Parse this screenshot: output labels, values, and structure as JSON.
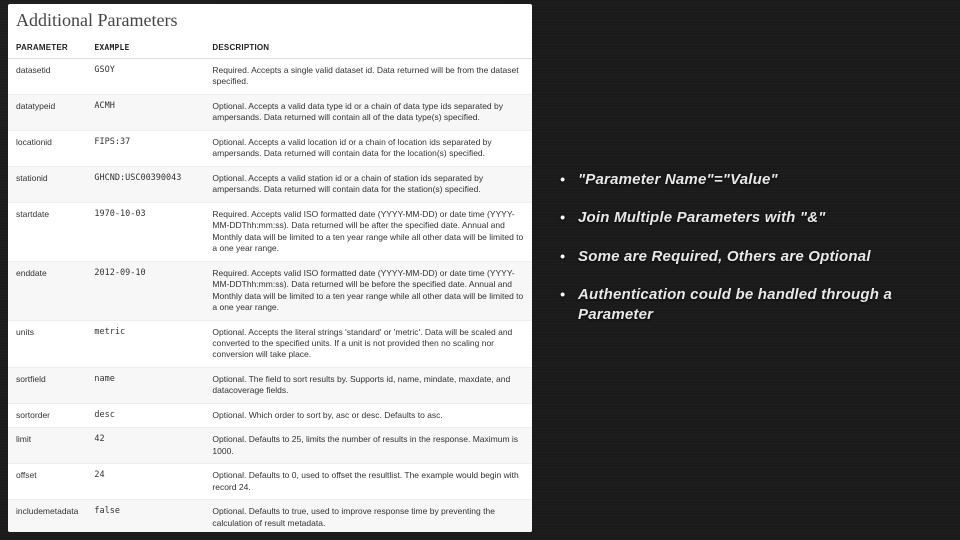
{
  "doc": {
    "title": "Additional Parameters",
    "headers": {
      "param": "PARAMETER",
      "example": "EXAMPLE",
      "desc": "DESCRIPTION"
    },
    "rows": [
      {
        "param": "datasetid",
        "example": "GSOY",
        "desc": "Required. Accepts a single valid dataset id. Data returned will be from the dataset specified."
      },
      {
        "param": "datatypeid",
        "example": "ACMH",
        "desc": "Optional. Accepts a valid data type id or a chain of data type ids separated by ampersands. Data returned will contain all of the data type(s) specified."
      },
      {
        "param": "locationid",
        "example": "FIPS:37",
        "desc": "Optional. Accepts a valid location id or a chain of location ids separated by ampersands. Data returned will contain data for the location(s) specified."
      },
      {
        "param": "stationid",
        "example": "GHCND:USC00390043",
        "desc": "Optional. Accepts a valid station id or a chain of station ids separated by ampersands. Data returned will contain data for the station(s) specified."
      },
      {
        "param": "startdate",
        "example": "1970-10-03",
        "desc": "Required. Accepts valid ISO formatted date (YYYY-MM-DD) or date time (YYYY-MM-DDThh:mm:ss). Data returned will be after the specified date. Annual and Monthly data will be limited to a ten year range while all other data will be limited to a one year range."
      },
      {
        "param": "enddate",
        "example": "2012-09-10",
        "desc": "Required. Accepts valid ISO formatted date (YYYY-MM-DD) or date time (YYYY-MM-DDThh:mm:ss). Data returned will be before the specified date. Annual and Monthly data will be limited to a ten year range while all other data will be limited to a one year range."
      },
      {
        "param": "units",
        "example": "metric",
        "desc": "Optional. Accepts the literal strings 'standard' or 'metric'. Data will be scaled and converted to the specified units. If a unit is not provided then no scaling nor conversion will take place."
      },
      {
        "param": "sortfield",
        "example": "name",
        "desc": "Optional. The field to sort results by. Supports id, name, mindate, maxdate, and datacoverage fields."
      },
      {
        "param": "sortorder",
        "example": "desc",
        "desc": "Optional. Which order to sort by, asc or desc. Defaults to asc."
      },
      {
        "param": "limit",
        "example": "42",
        "desc": "Optional. Defaults to 25, limits the number of results in the response. Maximum is 1000."
      },
      {
        "param": "offset",
        "example": "24",
        "desc": "Optional. Defaults to 0, used to offset the resultlist. The example would begin with record 24."
      },
      {
        "param": "includemetadata",
        "example": "false",
        "desc": "Optional. Defaults to true, used to improve response time by preventing the calculation of result metadata."
      }
    ]
  },
  "bullets": [
    "\"Parameter Name\"=\"Value\"",
    "Join Multiple Parameters with \"&\"",
    "Some are Required, Others are Optional",
    "Authentication could be handled through a Parameter"
  ]
}
